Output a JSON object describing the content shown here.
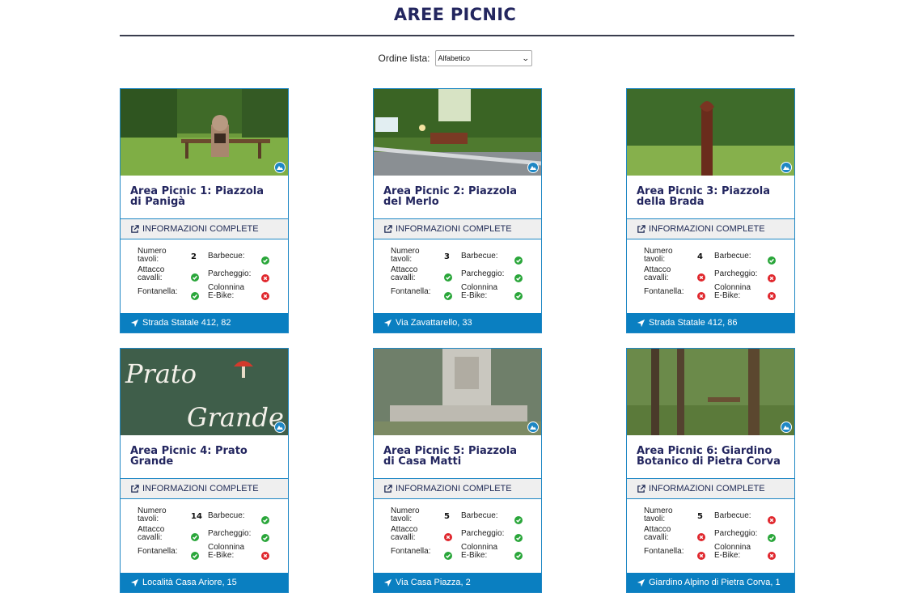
{
  "page": {
    "title": "AREE PICNIC"
  },
  "sort": {
    "label": "Ordine lista:",
    "selected": "Alfabetico"
  },
  "colors": {
    "accent": "#1e87c4",
    "address_bar": "#0a7fc1",
    "title": "#23265f",
    "ok": "#2aa63a",
    "no": "#e0262c"
  },
  "labels": {
    "tables": "Numero tavoli:",
    "horses": "Attacco cavalli:",
    "fountain": "Fontanella:",
    "barbecue": "Barbecue:",
    "parking": "Parcheggio:",
    "ebike": "Colonnina E-Bike:"
  },
  "cards": [
    {
      "title": "Area Picnic 1: Piazzola di Panigà",
      "info_label": "INFORMAZIONI COMPLETE",
      "tables": "2",
      "horses": "check-icon",
      "fountain": "check-icon",
      "barbecue": "check-icon",
      "parking": "cross-icon",
      "ebike": "cross-icon",
      "address": "Strada Statale 412, 82"
    },
    {
      "title": "Area Picnic 2: Piazzola del Merlo",
      "info_label": "INFORMAZIONI COMPLETE",
      "tables": "3",
      "horses": "check-icon",
      "fountain": "check-icon",
      "barbecue": "check-icon",
      "parking": "check-icon",
      "ebike": "check-icon",
      "address": "Via Zavattarello, 33"
    },
    {
      "title": "Area Picnic 3: Piazzola della Brada",
      "info_label": "INFORMAZIONI COMPLETE",
      "tables": "4",
      "horses": "cross-icon",
      "fountain": "cross-icon",
      "barbecue": "check-icon",
      "parking": "cross-icon",
      "ebike": "cross-icon",
      "address": "Strada Statale 412, 86"
    },
    {
      "title": "Area Picnic 4: Prato Grande",
      "info_label": "INFORMAZIONI COMPLETE",
      "tables": "14",
      "horses": "check-icon",
      "fountain": "check-icon",
      "barbecue": "check-icon",
      "parking": "check-icon",
      "ebike": "cross-icon",
      "address": "Località Casa Ariore, 15"
    },
    {
      "title": "Area Picnic 5: Piazzola di Casa Matti",
      "info_label": "INFORMAZIONI COMPLETE",
      "tables": "5",
      "horses": "cross-icon",
      "fountain": "check-icon",
      "barbecue": "check-icon",
      "parking": "check-icon",
      "ebike": "check-icon",
      "address": "Via Casa Piazza, 2"
    },
    {
      "title": "Area Picnic 6: Giardino Botanico di Pietra Corva",
      "info_label": "INFORMAZIONI COMPLETE",
      "tables": "5",
      "horses": "cross-icon",
      "fountain": "cross-icon",
      "barbecue": "cross-icon",
      "parking": "check-icon",
      "ebike": "cross-icon",
      "address": "Giardino Alpino di Pietra Corva, 1"
    }
  ]
}
